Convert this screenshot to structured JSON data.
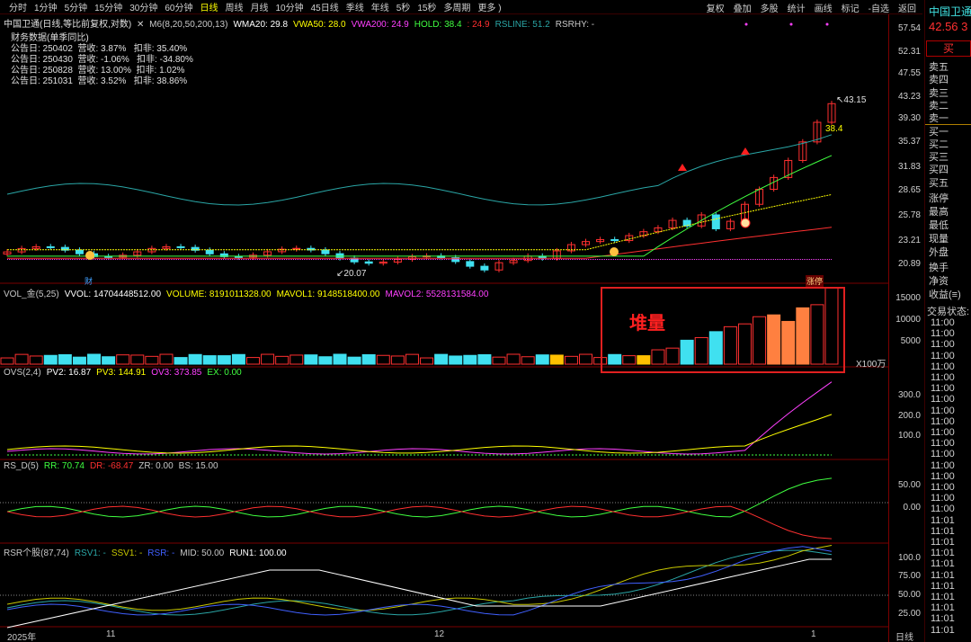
{
  "toolbar": {
    "periods": [
      "分时",
      "1分钟",
      "5分钟",
      "15分钟",
      "30分钟",
      "60分钟",
      "日线",
      "周线",
      "月线",
      "10分钟",
      "45日线",
      "季线",
      "年线",
      "5秒",
      "15秒",
      "多周期",
      "更多 )"
    ],
    "active_period": "日线",
    "right_items": [
      "复权",
      "叠加",
      "多股",
      "统计",
      "画线",
      "标记",
      "-自选",
      "返回"
    ]
  },
  "main": {
    "title_line": "中国卫通(日线,等比前复权,对数)",
    "indicators": [
      {
        "text": "M6(8,20,50,200,13)",
        "color": "#c8c8c8"
      },
      {
        "text": "WMA20: 29.8",
        "color": "#ffffff"
      },
      {
        "text": "VWA50: 28.0",
        "color": "#ffff00"
      },
      {
        "text": "VWA200: 24.9",
        "color": "#ff40ff"
      },
      {
        "text": "HOLD: 38.4",
        "color": "#40ff40"
      },
      {
        "text": ": 24.9",
        "color": "#ff3030"
      },
      {
        "text": "RSLINE: 51.2",
        "color": "#2aa6a6"
      },
      {
        "text": "RSRHY: -",
        "color": "#c8c8c8"
      }
    ],
    "fin_title": "财务数据(单季同比)",
    "fin_rows": [
      "公告日: 250402  营收: 3.87%   扣非: 35.40%",
      "公告日: 250430  营收: -1.06%   扣非: -34.80%",
      "公告日: 250828  营收: 13.00%  扣非: 1.02%",
      "公告日: 251031  营收: 3.52%   扣非: 38.86%"
    ],
    "price_high_label": "43.15",
    "hold_label": "38.4",
    "price_low_label": "20.07",
    "marker_cai": "财",
    "marker_zhangting": "涨停"
  },
  "vol": {
    "indicators": [
      {
        "text": "VOL_金(5,25)",
        "color": "#c8c8c8"
      },
      {
        "text": "VVOL: 14704448512.00",
        "color": "#ffffff"
      },
      {
        "text": "VOLUME: 8191011328.00",
        "color": "#ffff00"
      },
      {
        "text": "MAVOL1: 9148518400.00",
        "color": "#ffff00"
      },
      {
        "text": "MAVOL2: 5528131584.00",
        "color": "#ff40ff"
      }
    ],
    "annotation": "堆量",
    "unit": "X100万"
  },
  "ovs": {
    "indicators": [
      {
        "text": "OVS(2,4)",
        "color": "#c8c8c8"
      },
      {
        "text": "PV2: 16.87",
        "color": "#ffffff"
      },
      {
        "text": "PV3: 144.91",
        "color": "#ffff00"
      },
      {
        "text": "OV3: 373.85",
        "color": "#ff40ff"
      },
      {
        "text": "EX: 0.00",
        "color": "#40ff40"
      }
    ]
  },
  "rsd": {
    "indicators": [
      {
        "text": "RS_D(5)",
        "color": "#c8c8c8"
      },
      {
        "text": "RR: 70.74",
        "color": "#40ff40"
      },
      {
        "text": "DR: -68.47",
        "color": "#ff3030"
      },
      {
        "text": "ZR: 0.00",
        "color": "#c8c8c8"
      },
      {
        "text": "BS: 15.00",
        "color": "#c8c8c8"
      }
    ]
  },
  "rsr": {
    "indicators": [
      {
        "text": "RSR个股(87,74)",
        "color": "#c8c8c8"
      },
      {
        "text": "RSV1: -",
        "color": "#2aa6a6"
      },
      {
        "text": "SSV1: -",
        "color": "#c8c800"
      },
      {
        "text": "RSR: -",
        "color": "#4060ff"
      },
      {
        "text": "MID: 50.00",
        "color": "#c8c8c8"
      },
      {
        "text": "RUN1: 100.00",
        "color": "#ffffff"
      }
    ]
  },
  "xaxis": {
    "labels": [
      "2025年",
      "11",
      "12",
      "1"
    ],
    "period": "日线"
  },
  "yaxis": {
    "price": [
      "57.54",
      "52.31",
      "47.55",
      "43.23",
      "39.30",
      "35.37",
      "31.83",
      "28.65",
      "25.78",
      "23.21",
      "20.89"
    ],
    "vol": [
      "15000",
      "10000",
      "5000"
    ],
    "ovs": [
      "300.0",
      "200.0",
      "100.0"
    ],
    "rsd": [
      "50.00",
      "0.00"
    ],
    "rsr": [
      "100.0",
      "75.00",
      "50.00",
      "25.00"
    ]
  },
  "side": {
    "stock_name": "中国卫通",
    "price": "42.56",
    "price_suffix": "3",
    "buy_button": "买",
    "orders": [
      "卖五",
      "卖四",
      "卖三",
      "卖二",
      "卖一",
      "买一",
      "买二",
      "买三",
      "买四",
      "买五"
    ],
    "stats": [
      "涨停",
      "最高",
      "最低",
      "现量",
      "外盘",
      "换手",
      "净资",
      "收益(≡)"
    ],
    "trade_status": "交易状态:",
    "times": [
      "11:00",
      "11:00",
      "11:00",
      "11:00",
      "11:00",
      "11:00",
      "11:00",
      "11:00",
      "11:00",
      "11:00",
      "11:00",
      "11:00",
      "11:00",
      "11:00",
      "11:00",
      "11:00",
      "11:00",
      "11:00",
      "11:01",
      "11:01",
      "11:01",
      "11:01",
      "11:01",
      "11:01",
      "11:01",
      "11:01",
      "11:01",
      "11:01",
      "11:01"
    ]
  },
  "colors": {
    "up": "#ff3030",
    "down": "#40e0f0",
    "yellow_bar": "#ffc000",
    "orange_bar": "#ff8040"
  },
  "chart_data": {
    "type": "candlestick",
    "title": "中国卫通(日线,等比前复权,对数)",
    "y_scale": "log",
    "ylim": [
      20.89,
      57.54
    ],
    "price_high": 43.15,
    "price_low": 20.07,
    "last_close": 42.56
  }
}
